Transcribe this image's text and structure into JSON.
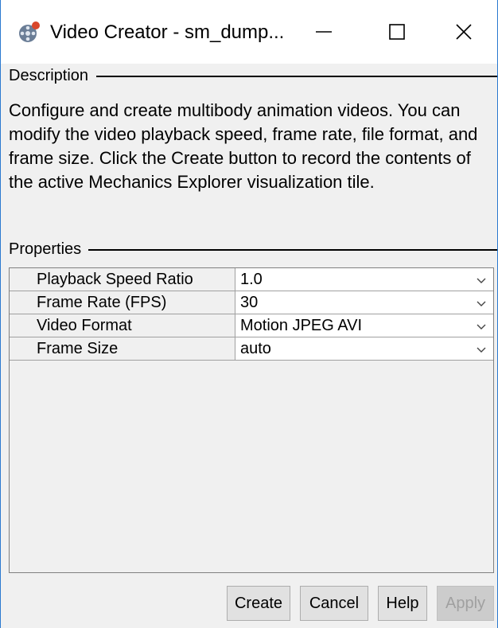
{
  "window": {
    "title": "Video Creator - sm_dump..."
  },
  "description": {
    "title": "Description",
    "text": "Configure and create multibody animation videos. You can modify the video playback speed, frame rate, file format, and frame size. Click the Create button to record the contents of the active Mechanics Explorer visualization tile."
  },
  "properties": {
    "title": "Properties",
    "rows": [
      {
        "name": "Playback Speed Ratio",
        "value": "1.0"
      },
      {
        "name": "Frame Rate (FPS)",
        "value": "30"
      },
      {
        "name": "Video Format",
        "value": "Motion JPEG AVI"
      },
      {
        "name": "Frame Size",
        "value": "auto"
      }
    ]
  },
  "buttons": {
    "create": "Create",
    "cancel": "Cancel",
    "help": "Help",
    "apply": "Apply"
  },
  "icons": {
    "app": "film-reel-icon",
    "minimize": "minimize-icon",
    "maximize": "maximize-icon",
    "close": "close-icon",
    "dropdown": "chevron-down-icon"
  },
  "colors": {
    "window_border": "#2b79d0",
    "panel_bg": "#f0f0f0",
    "disabled_text": "#a0a0a0"
  }
}
